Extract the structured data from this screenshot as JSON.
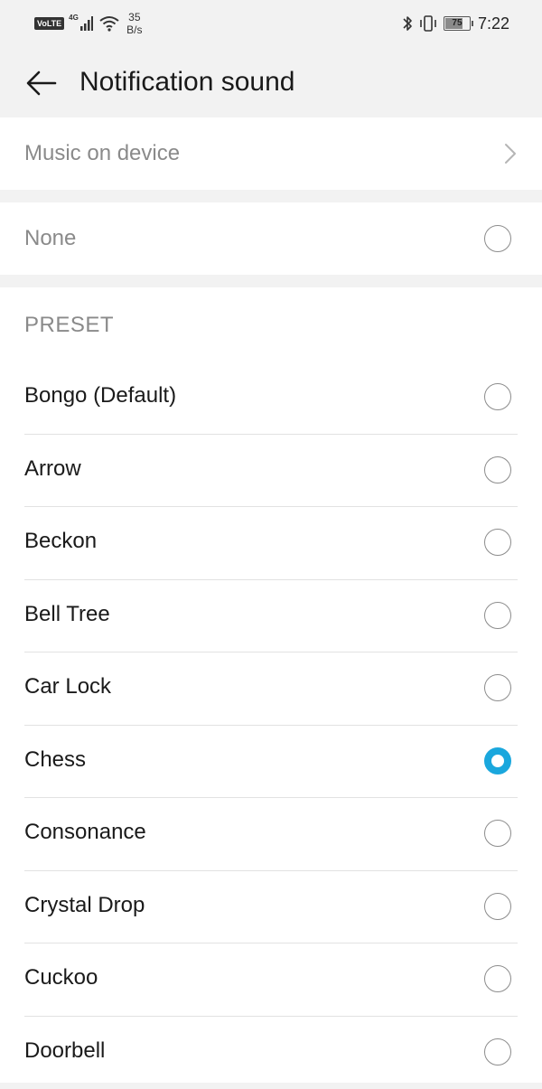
{
  "status_bar": {
    "volte": "VoLTE",
    "network": "4G",
    "speed_value": "35",
    "speed_unit": "B/s",
    "battery": "75",
    "battery_level": 0.75,
    "time": "7:22",
    "icons": [
      "volte-icon",
      "signal-icon",
      "wifi-icon",
      "bluetooth-icon",
      "vibrate-icon",
      "battery-icon"
    ]
  },
  "header": {
    "title": "Notification sound",
    "back_icon": "arrow-left-icon"
  },
  "music": {
    "label": "Music on device",
    "chevron_icon": "chevron-right-icon"
  },
  "none": {
    "label": "None",
    "selected": false
  },
  "preset": {
    "section_title": "PRESET",
    "items": [
      {
        "label": "Bongo (Default)",
        "selected": false
      },
      {
        "label": "Arrow",
        "selected": false
      },
      {
        "label": "Beckon",
        "selected": false
      },
      {
        "label": "Bell Tree",
        "selected": false
      },
      {
        "label": "Car Lock",
        "selected": false
      },
      {
        "label": "Chess",
        "selected": true
      },
      {
        "label": "Consonance",
        "selected": false
      },
      {
        "label": "Crystal Drop",
        "selected": false
      },
      {
        "label": "Cuckoo",
        "selected": false
      },
      {
        "label": "Doorbell",
        "selected": false
      }
    ]
  },
  "colors": {
    "accent": "#1aa7dd",
    "background": "#f2f2f2",
    "card": "#ffffff",
    "muted_text": "#8a8a8a"
  }
}
